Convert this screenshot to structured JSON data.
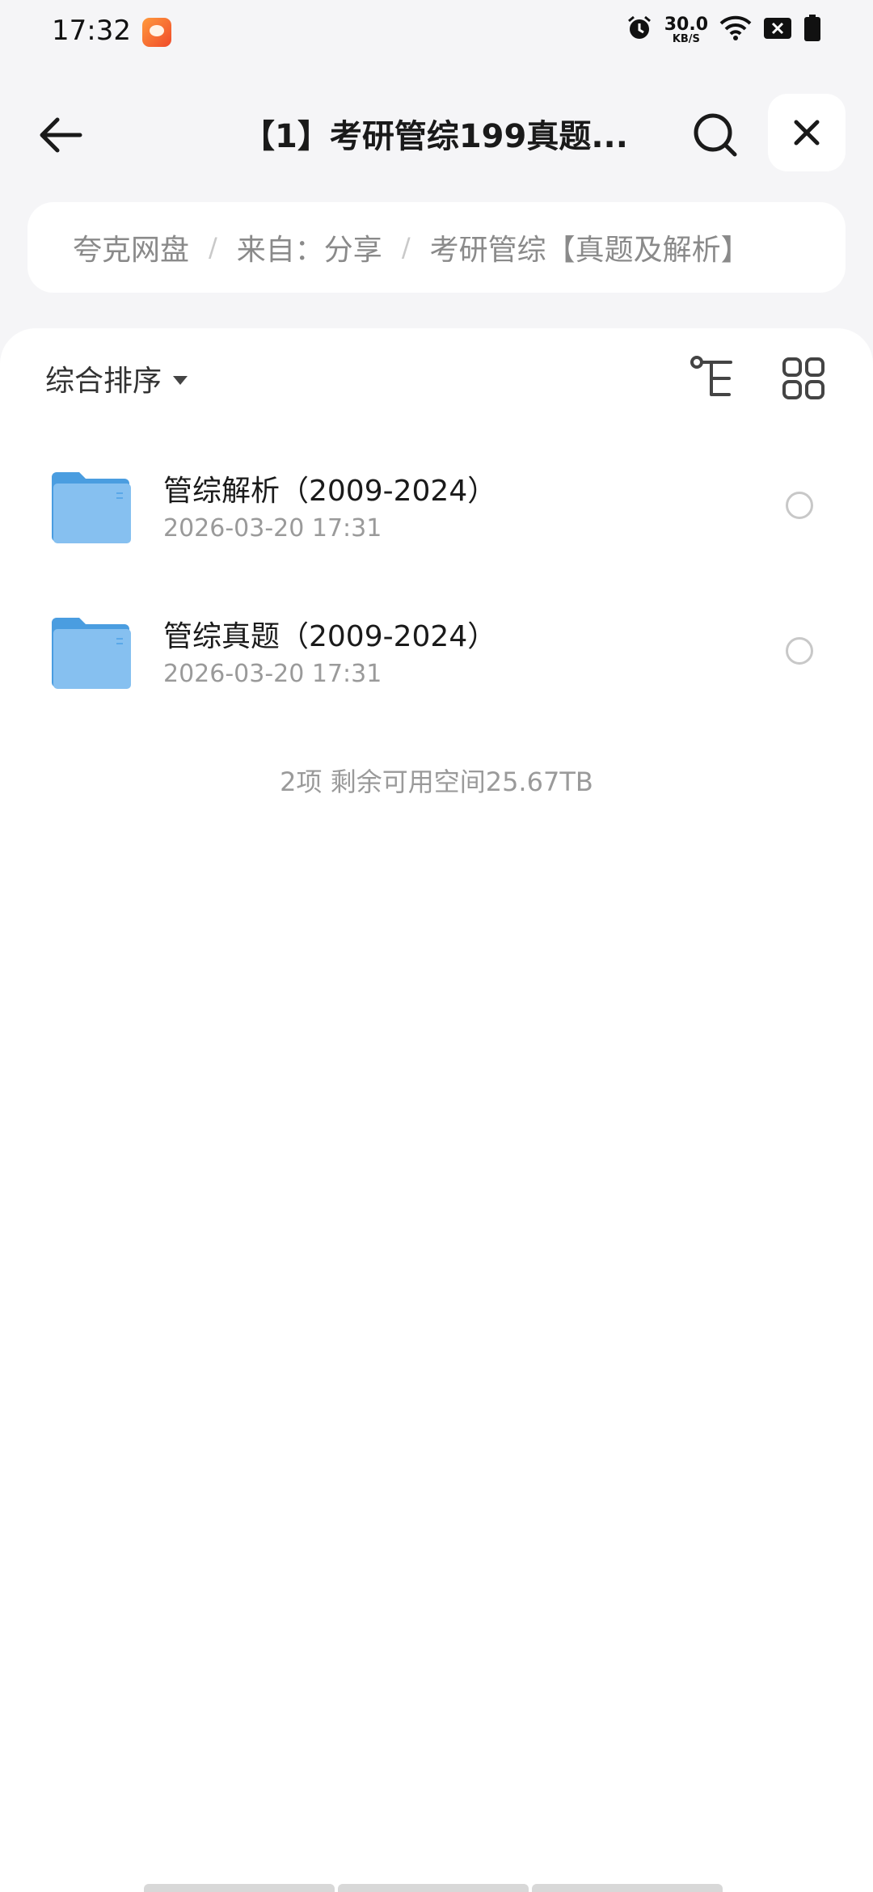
{
  "status_bar": {
    "time": "17:32",
    "net_speed_value": "30.0",
    "net_speed_unit": "KB/S",
    "icons": [
      "alarm-icon",
      "wifi-icon",
      "sim-icon",
      "battery-icon"
    ]
  },
  "header": {
    "title": "【1】考研管综199真题...",
    "back_icon": "back-arrow-icon",
    "search_icon": "search-icon",
    "close_icon": "close-icon"
  },
  "breadcrumb": {
    "items": [
      "夸克网盘",
      "来自：分享",
      "考研管综【真题及解析】"
    ],
    "separator": "/"
  },
  "toolbar": {
    "sort_label": "综合排序",
    "tree_icon": "tree-view-icon",
    "grid_icon": "grid-view-icon"
  },
  "files": [
    {
      "name": "管综解析（2009-2024）",
      "date": "2026-03-20 17:31",
      "type": "folder"
    },
    {
      "name": "管综真题（2009-2024）",
      "date": "2026-03-20 17:31",
      "type": "folder"
    }
  ],
  "summary": "2项 剩余可用空间25.67TB",
  "colors": {
    "folder_blue": "#5aa8e8",
    "background": "#f5f5f7",
    "panel": "#ffffff"
  }
}
